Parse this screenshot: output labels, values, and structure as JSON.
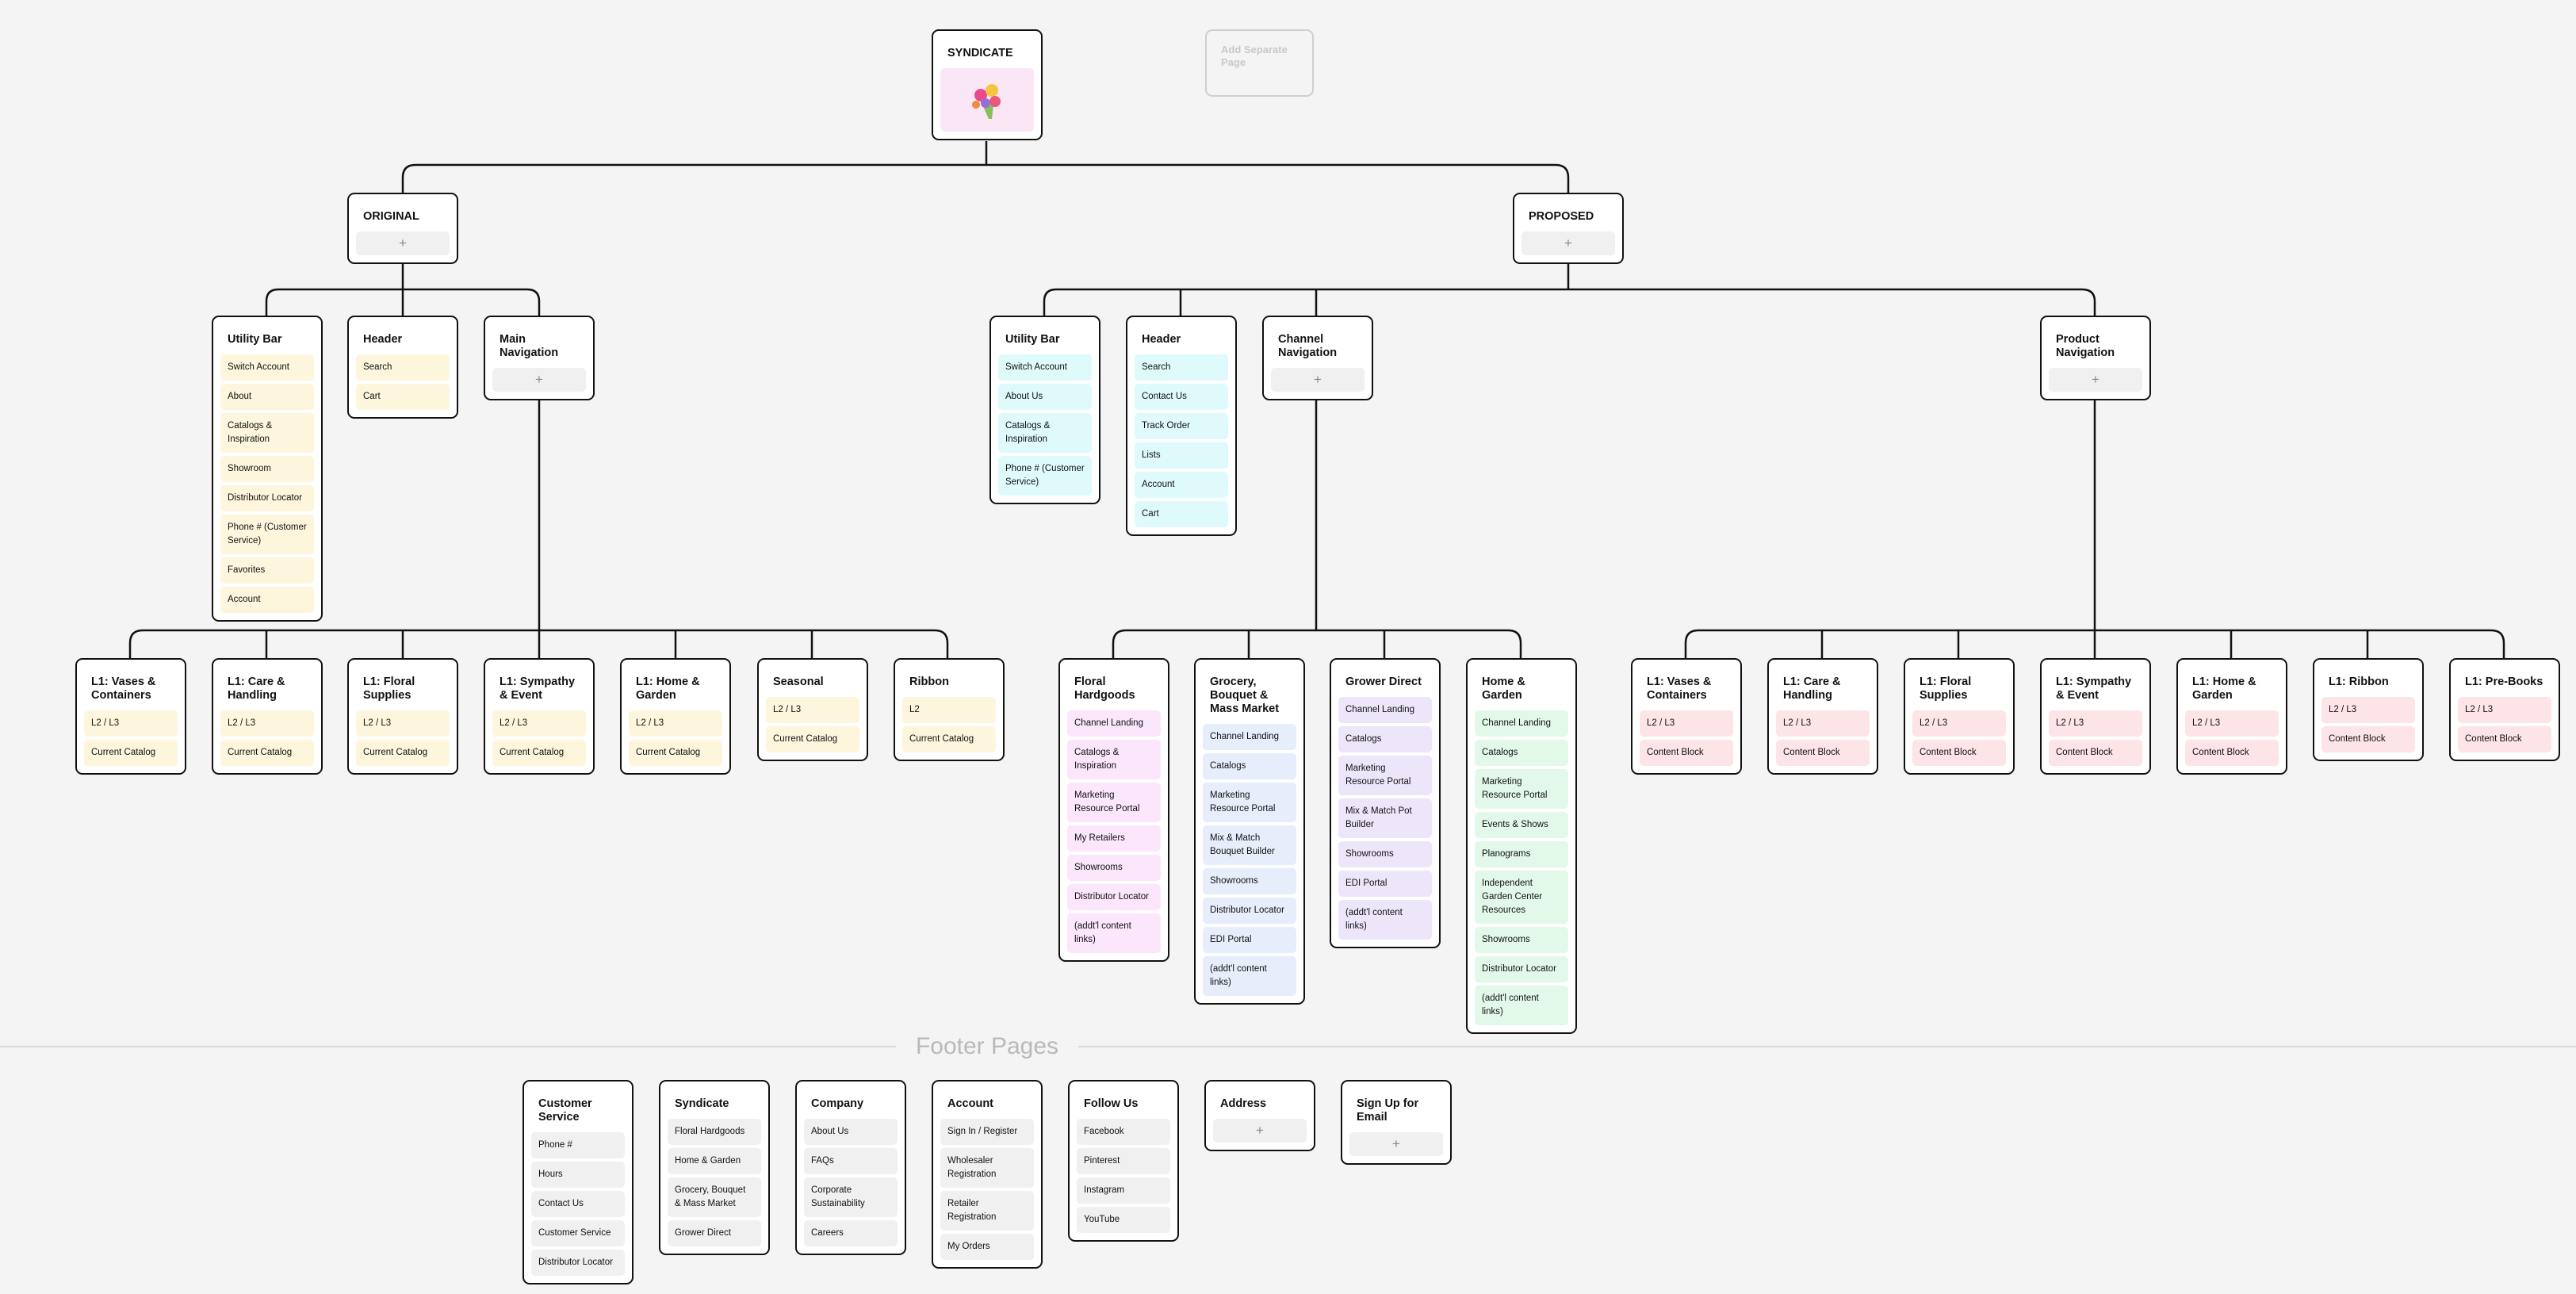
{
  "root": {
    "title": "SYNDICATE",
    "image_icon": "flower-bouquet-icon"
  },
  "ghost": {
    "label": "Add Separate Page"
  },
  "original": {
    "title": "ORIGINAL",
    "utility": {
      "title": "Utility Bar",
      "items": [
        "Switch Account",
        "About",
        "Catalogs & Inspiration",
        "Showroom",
        "Distributor Locator",
        "Phone # (Customer Service)",
        "Favorites",
        "Account"
      ]
    },
    "header": {
      "title": "Header",
      "items": [
        "Search",
        "Cart"
      ]
    },
    "main_nav": {
      "title": "Main Navigation"
    },
    "categories": [
      {
        "title": "L1: Vases & Containers",
        "items": [
          "L2 / L3",
          "Current Catalog"
        ]
      },
      {
        "title": "L1: Care & Handling",
        "items": [
          "L2 / L3",
          "Current Catalog"
        ]
      },
      {
        "title": "L1: Floral Supplies",
        "items": [
          "L2 / L3",
          "Current Catalog"
        ]
      },
      {
        "title": "L1: Sympathy & Event",
        "items": [
          "L2 / L3",
          "Current Catalog"
        ]
      },
      {
        "title": "L1: Home & Garden",
        "items": [
          "L2 / L3",
          "Current Catalog"
        ]
      },
      {
        "title": "Seasonal",
        "items": [
          "L2 / L3",
          "Current Catalog"
        ]
      },
      {
        "title": "Ribbon",
        "items": [
          "L2",
          "Current Catalog"
        ]
      }
    ]
  },
  "proposed": {
    "title": "PROPOSED",
    "utility": {
      "title": "Utility Bar",
      "items": [
        "Switch Account",
        "About Us",
        "Catalogs & Inspiration",
        "Phone # (Customer Service)"
      ]
    },
    "header": {
      "title": "Header",
      "items": [
        "Search",
        "Contact Us",
        "Track Order",
        "Lists",
        "Account",
        "Cart"
      ]
    },
    "channel_nav": {
      "title": "Channel Navigation"
    },
    "product_nav": {
      "title": "Product Navigation"
    },
    "channels": [
      {
        "title": "Floral Hardgoods",
        "items": [
          "Channel Landing",
          "Catalogs & Inspiration",
          "Marketing Resource Portal",
          "My Retailers",
          "Showrooms",
          "Distributor Locator",
          "(addt'l content links)"
        ]
      },
      {
        "title": "Grocery, Bouquet & Mass Market",
        "items": [
          "Channel Landing",
          "Catalogs",
          "Marketing Resource Portal",
          "Mix & Match Bouquet Builder",
          "Showrooms",
          "Distributor Locator",
          "EDI Portal",
          "(addt'l content links)"
        ]
      },
      {
        "title": "Grower Direct",
        "items": [
          "Channel Landing",
          "Catalogs",
          "Marketing Resource Portal",
          "Mix & Match Pot Builder",
          "Showrooms",
          "EDI Portal",
          "(addt'l content links)"
        ]
      },
      {
        "title": "Home & Garden",
        "items": [
          "Channel Landing",
          "Catalogs",
          "Marketing Resource Portal",
          "Events & Shows",
          "Planograms",
          "Independent Garden Center Resources",
          "Showrooms",
          "Distributor Locator",
          "(addt'l content links)"
        ]
      }
    ],
    "products": [
      {
        "title": "L1: Vases & Containers",
        "items": [
          "L2 / L3",
          "Content Block"
        ]
      },
      {
        "title": "L1: Care & Handling",
        "items": [
          "L2 / L3",
          "Content Block"
        ]
      },
      {
        "title": "L1: Floral Supplies",
        "items": [
          "L2 / L3",
          "Content Block"
        ]
      },
      {
        "title": "L1: Sympathy & Event",
        "items": [
          "L2 / L3",
          "Content Block"
        ]
      },
      {
        "title": "L1: Home & Garden",
        "items": [
          "L2 / L3",
          "Content Block"
        ]
      },
      {
        "title": "L1: Ribbon",
        "items": [
          "L2 / L3",
          "Content Block"
        ]
      },
      {
        "title": "L1: Pre-Books",
        "items": [
          "L2 / L3",
          "Content Block"
        ]
      }
    ]
  },
  "footer": {
    "label": "Footer Pages",
    "columns": [
      {
        "title": "Customer Service",
        "items": [
          "Phone #",
          "Hours",
          "Contact Us",
          "Customer Service",
          "Distributor Locator"
        ]
      },
      {
        "title": "Syndicate",
        "items": [
          "Floral Hardgoods",
          "Home & Garden",
          "Grocery, Bouquet & Mass Market",
          "Grower Direct"
        ]
      },
      {
        "title": "Company",
        "items": [
          "About Us",
          "FAQs",
          "Corporate Sustainability",
          "Careers"
        ]
      },
      {
        "title": "Account",
        "items": [
          "Sign In / Register",
          "Wholesaler Registration",
          "Retailer Registration",
          "My Orders"
        ]
      },
      {
        "title": "Follow Us",
        "items": [
          "Facebook",
          "Pinterest",
          "Instagram",
          "YouTube"
        ]
      },
      {
        "title": "Address",
        "items": []
      },
      {
        "title": "Sign Up for Email",
        "items": []
      }
    ]
  },
  "colors": {
    "line": "#111111",
    "original_items": "#fdf6dd",
    "proposed_utility_items": "#dffafb",
    "floral_hardgoods_items": "#fbe6fb",
    "grocery_items": "#e6eefc",
    "grower_items": "#ede6fb",
    "home_garden_items": "#e2f9e9",
    "product_items": "#fde4e6",
    "footer_items": "#f0f0f0"
  }
}
